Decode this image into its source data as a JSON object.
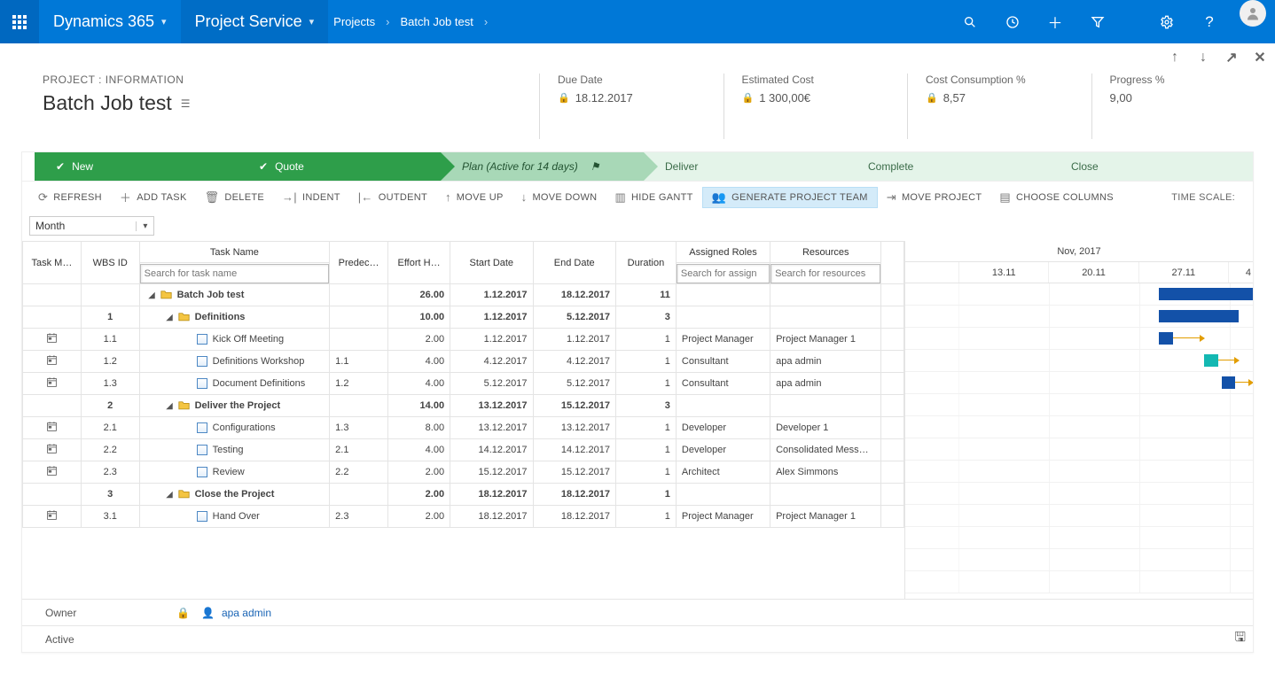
{
  "nav": {
    "brand": "Dynamics 365",
    "module": "Project Service",
    "breadcrumb": [
      "Projects",
      "Batch Job test"
    ]
  },
  "header": {
    "subtitle": "PROJECT : INFORMATION",
    "title": "Batch Job test",
    "metrics": {
      "due_date": {
        "label": "Due Date",
        "value": "18.12.2017",
        "locked": true
      },
      "est_cost": {
        "label": "Estimated Cost",
        "value": "1 300,00€",
        "locked": true
      },
      "cost_cons": {
        "label": "Cost Consumption %",
        "value": "8,57",
        "locked": true
      },
      "progress": {
        "label": "Progress %",
        "value": "9,00",
        "locked": false
      }
    }
  },
  "stages": [
    {
      "label": "New",
      "state": "done"
    },
    {
      "label": "Quote",
      "state": "done"
    },
    {
      "label": "Plan (Active for 14 days)",
      "state": "active"
    },
    {
      "label": "Deliver",
      "state": "future"
    },
    {
      "label": "Complete",
      "state": "future"
    },
    {
      "label": "Close",
      "state": "future"
    }
  ],
  "toolbar": {
    "refresh": "REFRESH",
    "add_task": "ADD TASK",
    "delete": "DELETE",
    "indent": "INDENT",
    "outdent": "OUTDENT",
    "move_up": "MOVE UP",
    "move_down": "MOVE DOWN",
    "hide_gantt": "HIDE GANTT",
    "gen_team": "GENERATE PROJECT TEAM",
    "move_project": "MOVE PROJECT",
    "choose_cols": "CHOOSE COLUMNS",
    "time_scale_label": "TIME SCALE:"
  },
  "time_scale": {
    "value": "Month"
  },
  "columns": {
    "task_mode": "Task M…",
    "wbs": "WBS ID",
    "task_name": "Task Name",
    "predecessors": "Predec…",
    "effort": "Effort H…",
    "start": "Start Date",
    "end": "End Date",
    "duration": "Duration",
    "roles": "Assigned Roles",
    "resources": "Resources"
  },
  "search_placeholders": {
    "task_name": "Search for task name",
    "roles": "Search for assign",
    "resources": "Search for resources"
  },
  "gantt_header": {
    "month": "Nov, 2017",
    "ticks": [
      "13.11",
      "20.11",
      "27.11",
      "4"
    ]
  },
  "rows": [
    {
      "type": "root",
      "wbs": "",
      "name": "Batch Job test",
      "pred": "",
      "effort": "26.00",
      "start": "1.12.2017",
      "end": "18.12.2017",
      "dur": "11",
      "roles": "",
      "res": ""
    },
    {
      "type": "group",
      "wbs": "1",
      "name": "Definitions",
      "pred": "",
      "effort": "10.00",
      "start": "1.12.2017",
      "end": "5.12.2017",
      "dur": "3",
      "roles": "",
      "res": ""
    },
    {
      "type": "task",
      "wbs": "1.1",
      "name": "Kick Off Meeting",
      "pred": "",
      "effort": "2.00",
      "start": "1.12.2017",
      "end": "1.12.2017",
      "dur": "1",
      "roles": "Project Manager",
      "res": "Project Manager 1"
    },
    {
      "type": "task",
      "wbs": "1.2",
      "name": "Definitions Workshop",
      "pred": "1.1",
      "effort": "4.00",
      "start": "4.12.2017",
      "end": "4.12.2017",
      "dur": "1",
      "roles": "Consultant",
      "res": "apa admin"
    },
    {
      "type": "task",
      "wbs": "1.3",
      "name": "Document Definitions",
      "pred": "1.2",
      "effort": "4.00",
      "start": "5.12.2017",
      "end": "5.12.2017",
      "dur": "1",
      "roles": "Consultant",
      "res": "apa admin"
    },
    {
      "type": "group",
      "wbs": "2",
      "name": "Deliver the Project",
      "pred": "",
      "effort": "14.00",
      "start": "13.12.2017",
      "end": "15.12.2017",
      "dur": "3",
      "roles": "",
      "res": ""
    },
    {
      "type": "task",
      "wbs": "2.1",
      "name": "Configurations",
      "pred": "1.3",
      "effort": "8.00",
      "start": "13.12.2017",
      "end": "13.12.2017",
      "dur": "1",
      "roles": "Developer",
      "res": "Developer 1"
    },
    {
      "type": "task",
      "wbs": "2.2",
      "name": "Testing",
      "pred": "2.1",
      "effort": "4.00",
      "start": "14.12.2017",
      "end": "14.12.2017",
      "dur": "1",
      "roles": "Developer",
      "res": "Consolidated Mess…"
    },
    {
      "type": "task",
      "wbs": "2.3",
      "name": "Review",
      "pred": "2.2",
      "effort": "2.00",
      "start": "15.12.2017",
      "end": "15.12.2017",
      "dur": "1",
      "roles": "Architect",
      "res": "Alex Simmons"
    },
    {
      "type": "group",
      "wbs": "3",
      "name": "Close the Project",
      "pred": "",
      "effort": "2.00",
      "start": "18.12.2017",
      "end": "18.12.2017",
      "dur": "1",
      "roles": "",
      "res": ""
    },
    {
      "type": "task",
      "wbs": "3.1",
      "name": "Hand Over",
      "pred": "2.3",
      "effort": "2.00",
      "start": "18.12.2017",
      "end": "18.12.2017",
      "dur": "1",
      "roles": "Project Manager",
      "res": "Project Manager 1"
    }
  ],
  "owner_row": {
    "label": "Owner",
    "name": "apa admin"
  },
  "status_row": {
    "status": "Active"
  }
}
